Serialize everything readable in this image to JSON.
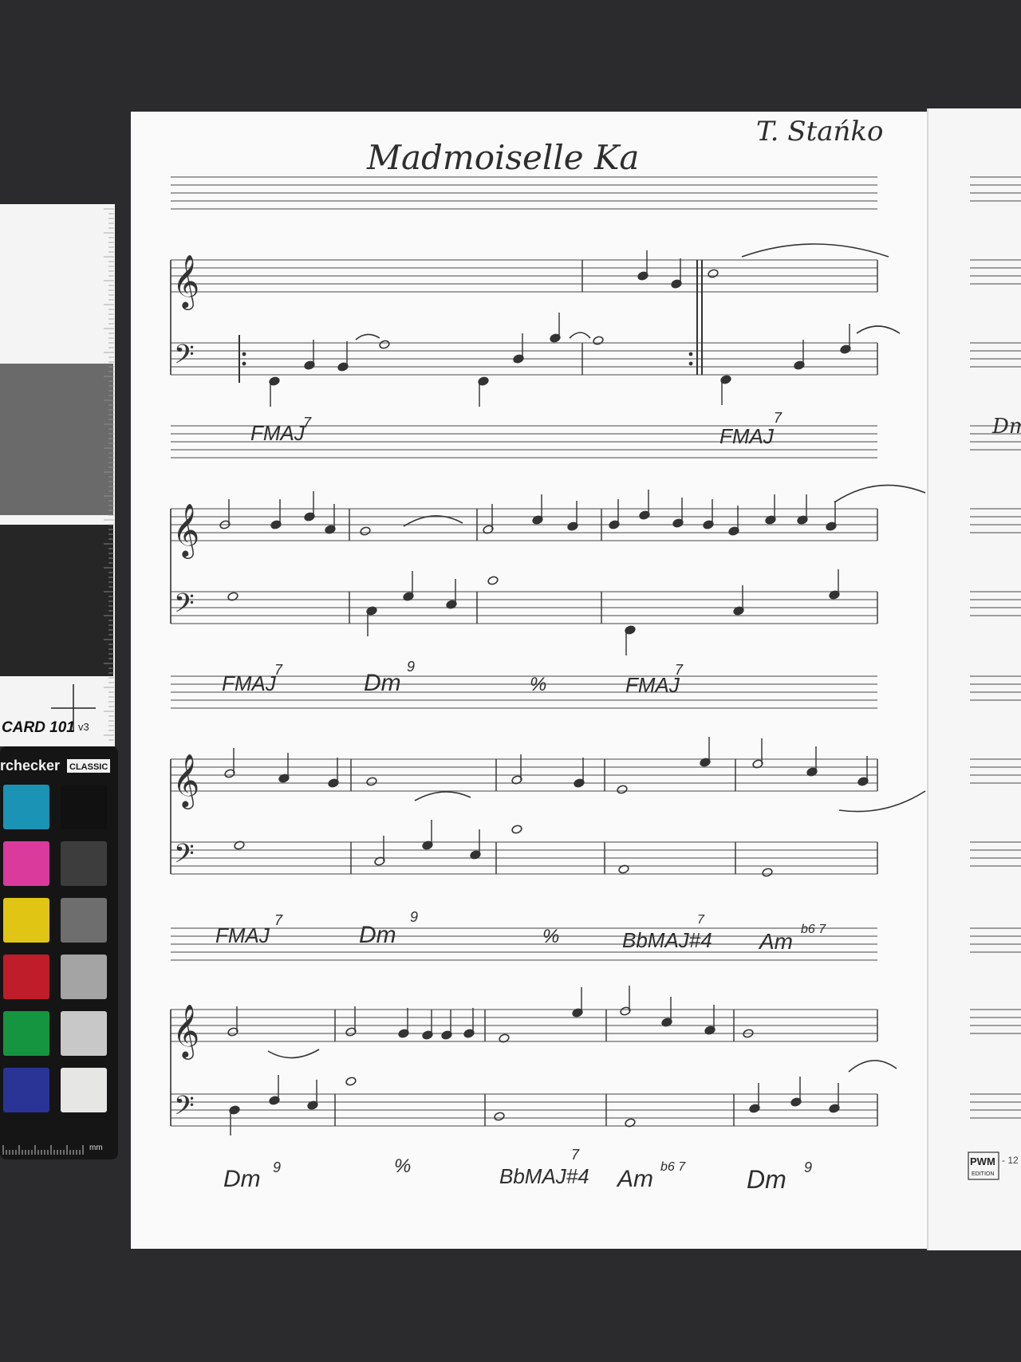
{
  "score": {
    "title": "Madmoiselle Ka",
    "composer": "T. Stańko",
    "systems": [
      {
        "chords": [
          {
            "label": "FMAJ",
            "ext": "7"
          },
          {
            "label": "FMAJ",
            "ext": "7"
          }
        ]
      },
      {
        "chords": [
          {
            "label": "FMAJ",
            "ext": "7"
          },
          {
            "label": "Dm",
            "ext": "9"
          },
          {
            "label": "%",
            "ext": ""
          },
          {
            "label": "FMAJ",
            "ext": "7"
          }
        ]
      },
      {
        "chords": [
          {
            "label": "FMAJ",
            "ext": "7"
          },
          {
            "label": "Dm",
            "ext": "9"
          },
          {
            "label": "%",
            "ext": ""
          },
          {
            "label": "BbMAJ#4",
            "ext": "7"
          },
          {
            "label": "Am",
            "ext": "b6 7"
          }
        ]
      },
      {
        "chords": [
          {
            "label": "Dm",
            "ext": "9"
          },
          {
            "label": "%",
            "ext": ""
          },
          {
            "label": "BbMAJ#4",
            "ext": "7"
          },
          {
            "label": "Am",
            "ext": "b6 7"
          },
          {
            "label": "Dm",
            "ext": "9"
          }
        ]
      }
    ],
    "next_page_chord": "Dm"
  },
  "color_card": {
    "label": "CARD 101",
    "version": "v3",
    "brand": "rchecker",
    "brand_tag": "CLASSIC",
    "unit": "mm",
    "swatches": [
      "#1a93b5",
      "#111111",
      "#d93a9c",
      "#3d3d3d",
      "#e0c515",
      "#6e6e6e",
      "#c01d2b",
      "#a4a4a4",
      "#15953f",
      "#c8c8c8",
      "#2a3396",
      "#e6e6e4"
    ]
  },
  "publisher": {
    "logo": "PWM",
    "sub": "EDITION",
    "page": "- 12"
  },
  "colors": {
    "background": "#2b2b2d",
    "paper": "#fafafa",
    "ink": "#333333"
  }
}
